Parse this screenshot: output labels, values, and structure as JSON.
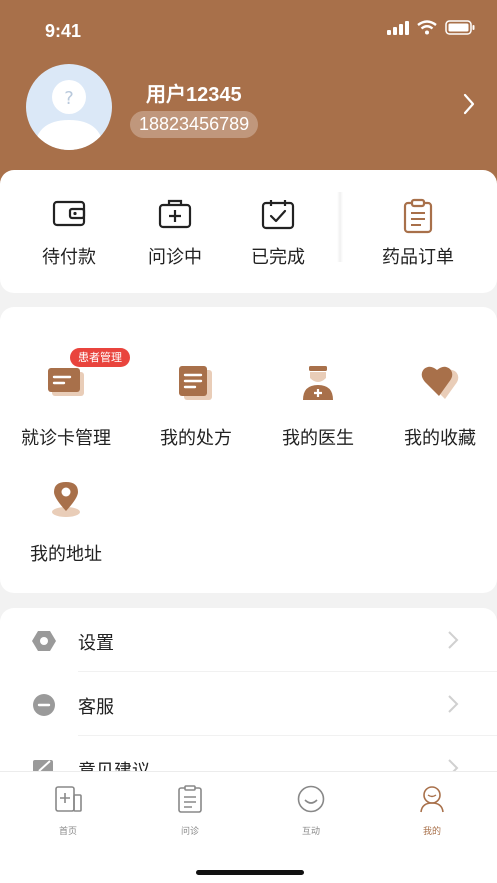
{
  "status": {
    "time": "9:41"
  },
  "profile": {
    "username": "用户12345",
    "phone": "18823456789"
  },
  "orders": [
    {
      "label": "待付款",
      "icon": "wallet-icon"
    },
    {
      "label": "问诊中",
      "icon": "medical-kit-icon"
    },
    {
      "label": "已完成",
      "icon": "calendar-check-icon"
    },
    {
      "label": "药品订单",
      "icon": "clipboard-icon"
    }
  ],
  "services": {
    "badge": "患者管理",
    "items": [
      {
        "label": "就诊卡管理",
        "icon": "card-icon"
      },
      {
        "label": "我的处方",
        "icon": "prescription-icon"
      },
      {
        "label": "我的医生",
        "icon": "doctor-icon"
      },
      {
        "label": "我的收藏",
        "icon": "heart-icon"
      },
      {
        "label": "我的地址",
        "icon": "location-pin-icon"
      }
    ]
  },
  "settings": [
    {
      "label": "设置",
      "icon": "hexagon-settings-icon"
    },
    {
      "label": "客服",
      "icon": "chat-icon"
    },
    {
      "label": "意见建议",
      "icon": "feedback-icon"
    }
  ],
  "tabbar": [
    {
      "label": "首页",
      "icon": "home-icon",
      "active": false
    },
    {
      "label": "问诊",
      "icon": "consult-icon",
      "active": false
    },
    {
      "label": "互动",
      "icon": "smile-icon",
      "active": false
    },
    {
      "label": "我的",
      "icon": "user-icon",
      "active": true
    }
  ],
  "colors": {
    "brand": "#a8704a",
    "accent_light": "#e9cdb8",
    "badge": "#e9443d"
  }
}
